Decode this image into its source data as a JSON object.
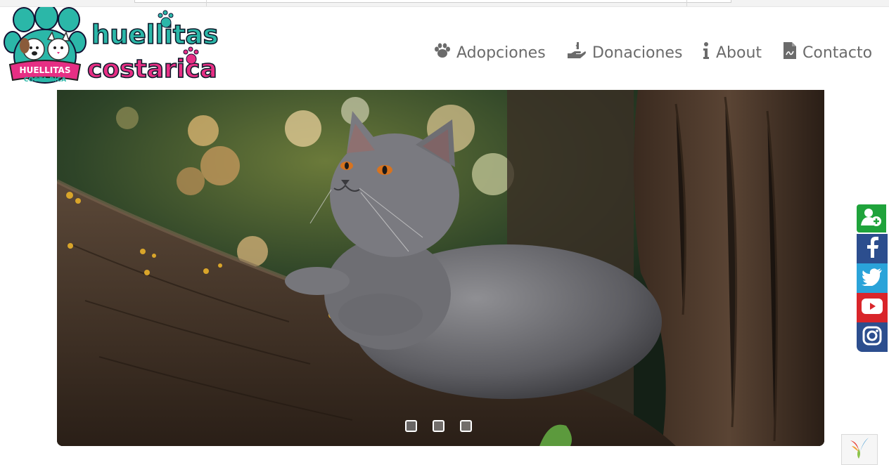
{
  "header": {
    "logo_alt_line1": "huellitas",
    "logo_alt_line2": "costarica",
    "badge_line1": "HUELLITAS",
    "badge_line2": "COSTA RICA"
  },
  "nav": {
    "items": [
      {
        "label": "Adopciones",
        "icon": "paw-icon"
      },
      {
        "label": "Donaciones",
        "icon": "hand-donation-icon"
      },
      {
        "label": "About",
        "icon": "info-icon"
      },
      {
        "label": "Contacto",
        "icon": "document-icon"
      }
    ]
  },
  "carousel": {
    "slide_count": 3,
    "active_index": 0,
    "current_image": "gray cat resting on tree branch"
  },
  "social": {
    "items": [
      "register-user-icon",
      "facebook-icon",
      "twitter-icon",
      "youtube-icon",
      "instagram-icon"
    ],
    "colors": {
      "register": "#1fa33b",
      "facebook": "#2c4e8e",
      "twitter": "#2aa3d9",
      "youtube": "#d9252a",
      "instagram": "#2c4e8e"
    }
  },
  "footer_badge": "yii-logo-icon",
  "colors": {
    "nav_text": "#6b6b6b",
    "brand_teal": "#2bb7a8",
    "brand_pink": "#e62f84"
  }
}
